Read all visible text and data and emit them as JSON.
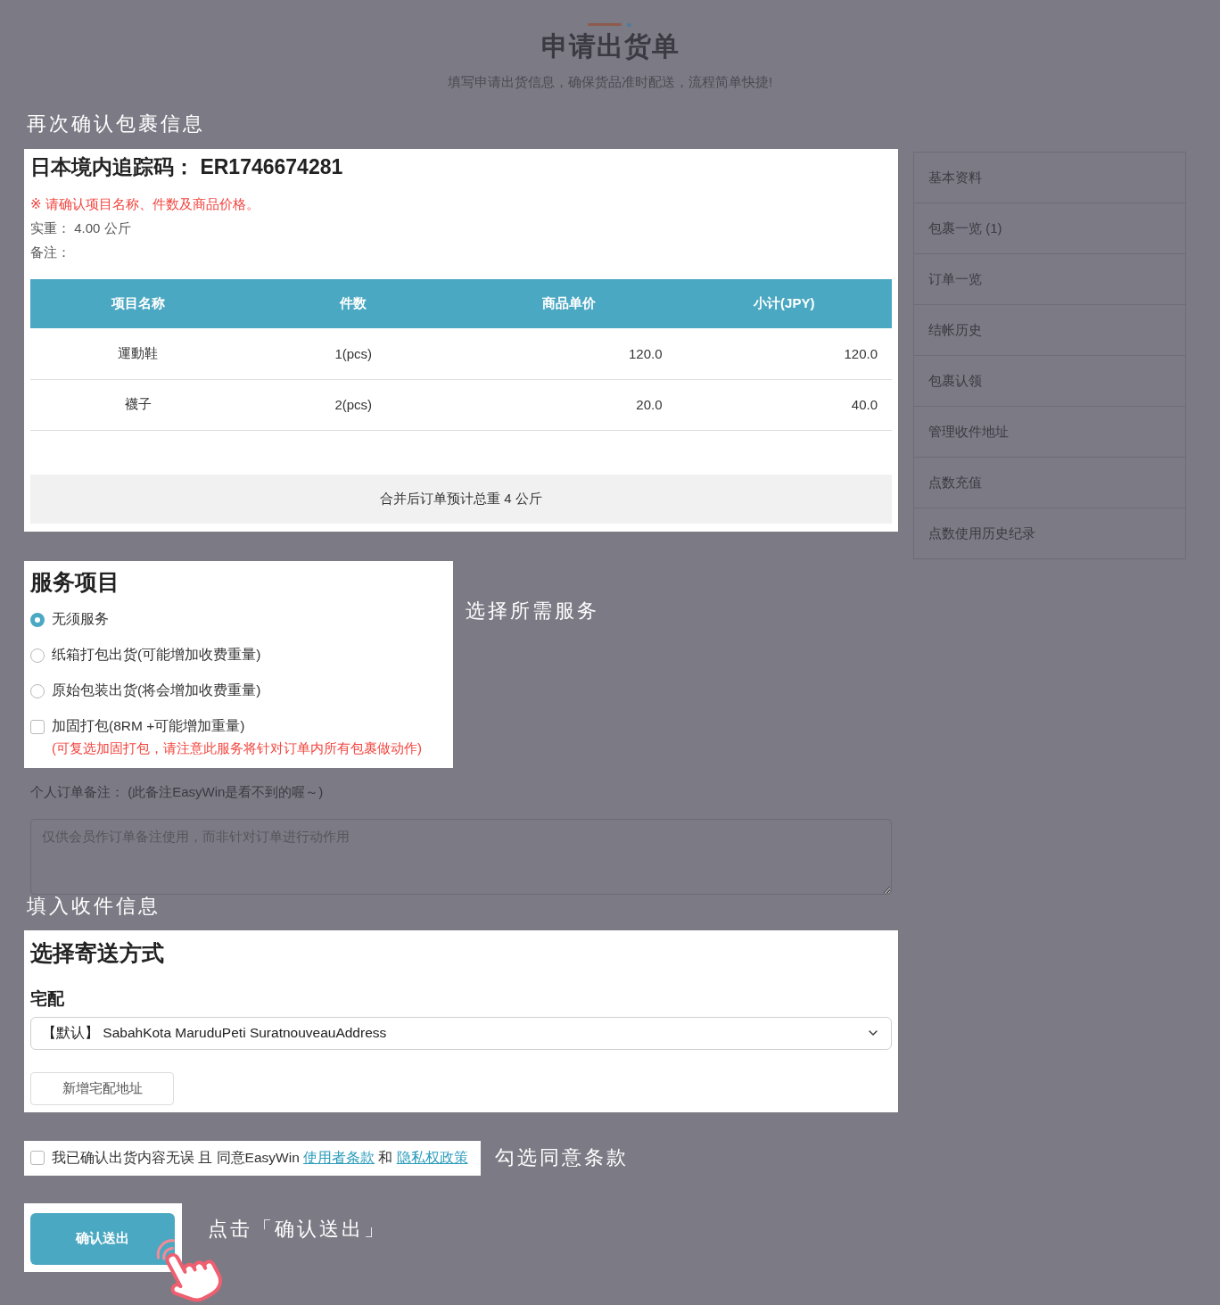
{
  "header": {
    "title": "申请出货单",
    "subtitle": "填写申请出货信息，确保货品准时配送，流程简单快捷!"
  },
  "package": {
    "annotation": "再次确认包裹信息",
    "tracking": "日本境内追踪码： ER1746674281",
    "notice": "※ 请确认项目名称、件数及商品价格。",
    "weight": "实重： 4.00 公斤",
    "remark": "备注：",
    "table": {
      "columns": [
        "项目名称",
        "件数",
        "商品单价",
        "小计(JPY)"
      ],
      "rows": [
        [
          "運動鞋",
          "1(pcs)",
          "120.0",
          "120.0"
        ],
        [
          "襪子",
          "2(pcs)",
          "20.0",
          "40.0"
        ]
      ]
    },
    "summary": "合并后订单预计总重 4 公斤"
  },
  "sidebar": {
    "items": [
      "基本资料",
      "包裹一览 (1)",
      "订单一览",
      "结帐历史",
      "包裹认领",
      "管理收件地址",
      "点数充值",
      "点数使用历史纪录"
    ]
  },
  "services": {
    "title": "服务项目",
    "annotation": "选择所需服务",
    "options": [
      {
        "kind": "radio",
        "label": "无须服务",
        "selected": true
      },
      {
        "kind": "radio",
        "label": "纸箱打包出货(可能增加收费重量)",
        "selected": false
      },
      {
        "kind": "radio",
        "label": "原始包装出货(将会增加收费重量)",
        "selected": false
      },
      {
        "kind": "checkbox",
        "label": "加固打包(8RM +可能增加重量)",
        "checked": false,
        "note": "(可复选加固打包，请注意此服务将针对订单内所有包裹做动作)"
      }
    ]
  },
  "order_note": {
    "label": "个人订单备注： (此备注EasyWin是看不到的喔～)",
    "placeholder": "仅供会员作订单备注使用，而非针对订单进行动作用"
  },
  "shipping": {
    "annotation": "填入收件信息",
    "title": "选择寄送方式",
    "method": "宅配",
    "address": "【默认】 SabahKota MaruduPeti SuratnouveauAddress",
    "add_button": "新增宅配地址"
  },
  "agreement": {
    "checked": false,
    "text": "我已确认出货内容无误 且 同意EasyWin",
    "terms_link": "使用者条款",
    "conjunction": "和",
    "privacy_link": "隐私权政策",
    "annotation": "勾选同意条款"
  },
  "submit": {
    "button": "确认送出",
    "annotation": "点击「确认送出」"
  }
}
